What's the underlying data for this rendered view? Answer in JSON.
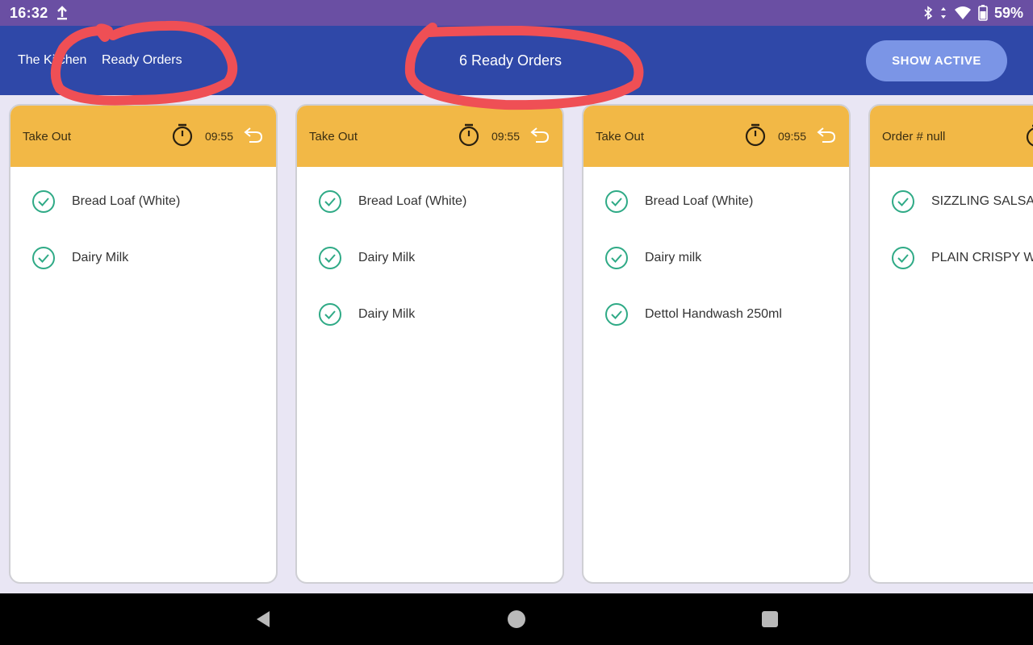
{
  "status_bar": {
    "time": "16:32",
    "battery": "59%",
    "icons": [
      "upload-icon",
      "bluetooth-icon",
      "data-arrows-icon",
      "wifi-icon",
      "battery-icon"
    ]
  },
  "app_bar": {
    "restaurant": "The Kitchen",
    "section": "Ready Orders",
    "orders_count": "6 Ready Orders",
    "show_active_label": "SHOW ACTIVE"
  },
  "colors": {
    "status_bar": "#6a4fa3",
    "app_bar": "#2f48a8",
    "button": "#7b95e6",
    "card_header": "#f2b846",
    "check": "#2faa86",
    "annotation": "#ef4f55"
  },
  "orders": [
    {
      "label": "Take Out",
      "elapsed": "09:55",
      "items": [
        "Bread Loaf (White)",
        "Dairy Milk"
      ]
    },
    {
      "label": "Take Out",
      "elapsed": "09:55",
      "items": [
        "Bread Loaf (White)",
        "Dairy Milk",
        "Dairy Milk"
      ]
    },
    {
      "label": "Take Out",
      "elapsed": "09:55",
      "items": [
        "Bread Loaf (White)",
        "Dairy milk",
        "Dettol Handwash 250ml"
      ]
    },
    {
      "label": "Order # null",
      "elapsed": "",
      "items": [
        "SIZZLING SALSA",
        "PLAIN CRISPY WI"
      ]
    }
  ],
  "nav_bar": {
    "buttons": [
      "back-button",
      "home-button",
      "recents-button"
    ]
  }
}
